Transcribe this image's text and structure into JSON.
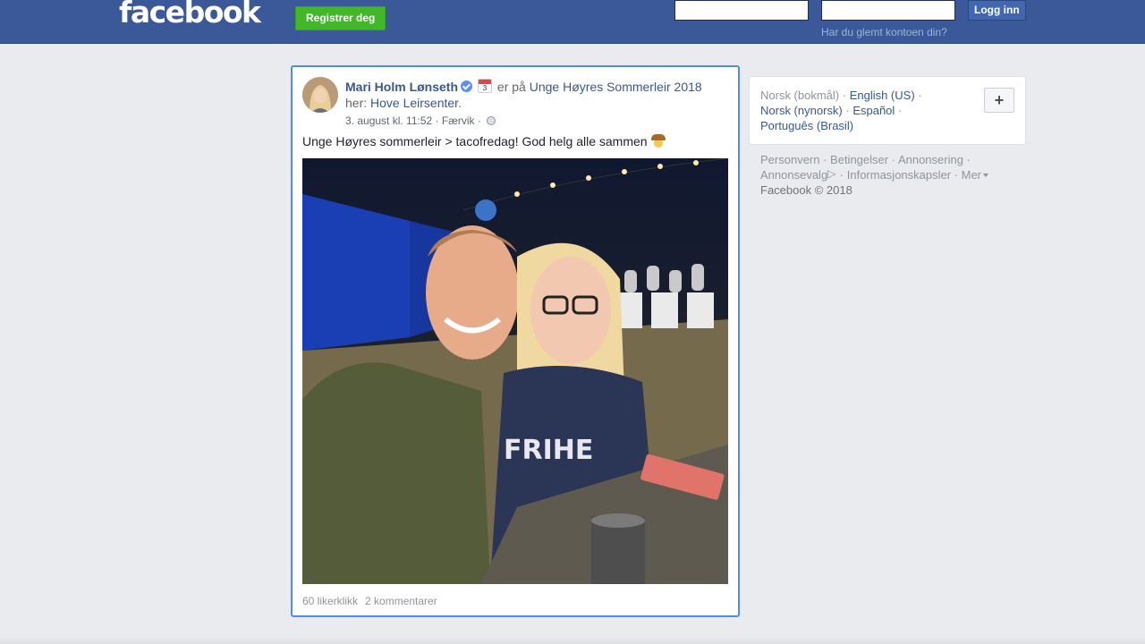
{
  "topbar": {
    "logo": "facebook",
    "register_label": "Registrer deg",
    "email_value": "",
    "password_value": "",
    "login_label": "Logg inn",
    "forgot_label": "Har du glemt kontoen din?"
  },
  "post": {
    "author": "Mari Holm Lønseth",
    "calendar_day": "3",
    "event_prefix": "er på",
    "event_name": "Unge Høyres Sommerleir 2018",
    "place_prefix": "her:",
    "place_name": "Hove Leirsenter",
    "timestamp": "3. august kl. 11:52",
    "location": "Færvik",
    "text": "Unge Høyres sommerleir > tacofredag! God helg alle sammen",
    "photo_text": "FRIHE",
    "likes": "60 likerklikk",
    "comments": "2 kommentarer"
  },
  "languages": {
    "current": "Norsk (bokmål)",
    "items": [
      "English (US)",
      "Norsk (nynorsk)",
      "Español",
      "Português (Brasil)"
    ],
    "plus_label": "+"
  },
  "footer": {
    "links": [
      "Personvern",
      "Betingelser",
      "Annonsering",
      "Annonsevalg",
      "Informasjonskapsler",
      "Mer"
    ],
    "copyright": "Facebook © 2018"
  },
  "colors": {
    "brand": "#3b5998",
    "link": "#365899",
    "register_green": "#42b72a",
    "focus_border": "#4f8bf5"
  }
}
